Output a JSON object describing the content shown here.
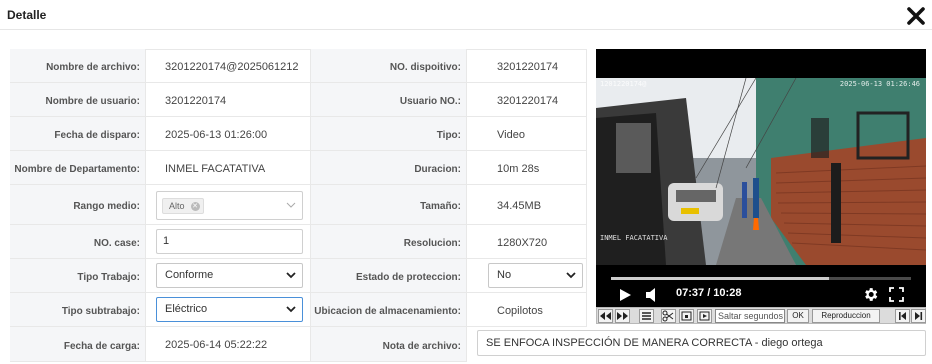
{
  "dialog": {
    "title": "Detalle",
    "close_icon": "close-icon"
  },
  "form": {
    "nombre_archivo": {
      "label": "Nombre de archivo:",
      "value": "3201220174@2025061212"
    },
    "no_dispositivo": {
      "label": "NO. dispoitivo:",
      "value": "3201220174"
    },
    "nombre_usuario": {
      "label": "Nombre de usuario:",
      "value": "3201220174"
    },
    "usuario_no": {
      "label": "Usuario NO.:",
      "value": "3201220174"
    },
    "fecha_disparo": {
      "label": "Fecha de disparo:",
      "value": "2025-06-13 01:26:00"
    },
    "tipo": {
      "label": "Tipo:",
      "value": "Video"
    },
    "departamento": {
      "label": "Nombre de Departamento:",
      "value": "INMEL FACATATIVA"
    },
    "duracion": {
      "label": "Duracion:",
      "value": "10m 28s"
    },
    "rango_medio": {
      "label": "Rango medio:",
      "tag": "Alto"
    },
    "tamano": {
      "label": "Tamaño:",
      "value": "34.45MB"
    },
    "no_case": {
      "label": "NO. case:",
      "value": "1"
    },
    "resolucion": {
      "label": "Resolucion:",
      "value": "1280X720"
    },
    "tipo_trabajo": {
      "label": "Tipo Trabajo:",
      "value": "Conforme"
    },
    "estado_proteccion": {
      "label": "Estado de proteccion:",
      "value": "No"
    },
    "tipo_subtrabajo": {
      "label": "Tipo subtrabajo:",
      "value": "Eléctrico"
    },
    "ubicacion": {
      "label": "Ubicacion de almacenamiento:",
      "value": "Copilotos"
    },
    "fecha_carga": {
      "label": "Fecha de carga:",
      "value": "2025-06-14 05:22:22"
    },
    "nota_archivo": {
      "label": "Nota de archivo:",
      "value": "SE ENFOCA INSPECCIÓN DE MANERA CORRECTA - diego ortega"
    }
  },
  "player": {
    "current_time": "07:37",
    "duration": "10:28",
    "time_display": "07:37 / 10:28",
    "progress_fraction": 0.727,
    "osd_top_left": "1201220174@",
    "osd_top_right": "2025-06-13 01:26:46",
    "osd_bottom": "INMEL FACATATIVA"
  },
  "toolbar": {
    "skip_placeholder": "Saltar segundos",
    "ok_label": "OK",
    "playback_label": "Reproduccion"
  }
}
